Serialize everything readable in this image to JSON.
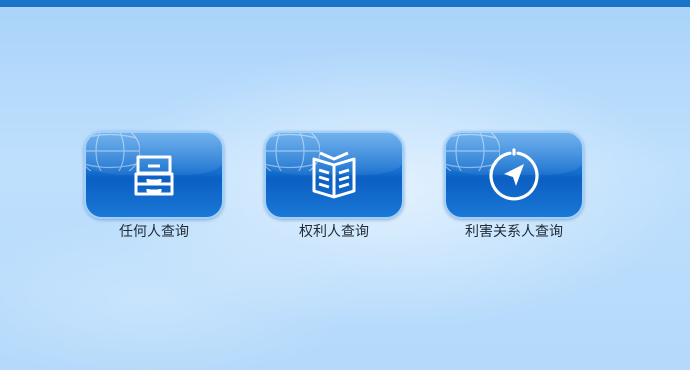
{
  "menu": {
    "items": [
      {
        "label": "任何人查询",
        "icon": "drawer-cabinet-icon"
      },
      {
        "label": "权利人查询",
        "icon": "open-book-icon"
      },
      {
        "label": "利害关系人查询",
        "icon": "compass-icon"
      }
    ]
  },
  "colors": {
    "top_bar": "#1a74c8",
    "tile_blue": "#1670cf",
    "label_text": "#1e2a36"
  }
}
